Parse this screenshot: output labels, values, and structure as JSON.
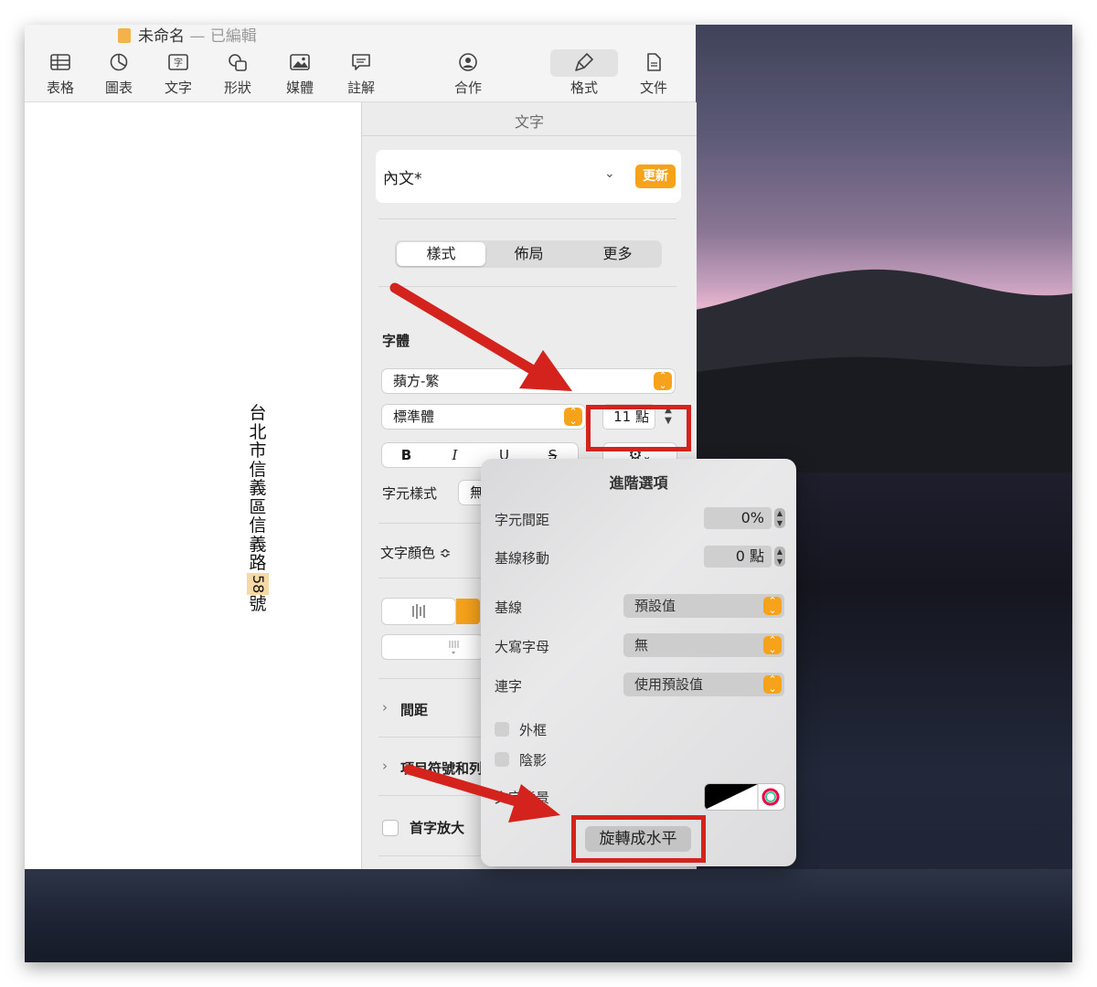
{
  "window": {
    "title": "未命名",
    "title_sep": " — ",
    "title_status": "已編輯"
  },
  "toolbar": {
    "items": [
      {
        "label": "表格",
        "icon": "table-icon"
      },
      {
        "label": "圖表",
        "icon": "chart-icon"
      },
      {
        "label": "文字",
        "icon": "text-box-icon"
      },
      {
        "label": "形狀",
        "icon": "shape-icon"
      },
      {
        "label": "媒體",
        "icon": "media-icon"
      },
      {
        "label": "註解",
        "icon": "comment-icon"
      },
      {
        "label": "合作",
        "icon": "collaborate-icon"
      },
      {
        "label": "格式",
        "icon": "format-brush-icon"
      },
      {
        "label": "文件",
        "icon": "document-icon"
      }
    ]
  },
  "canvas": {
    "vertical_text_chars": [
      "台",
      "北",
      "市",
      "信",
      "義",
      "區",
      "信",
      "義",
      "路"
    ],
    "number": "58",
    "last_char": "號"
  },
  "inspector": {
    "title": "文字",
    "paragraph_style": "內文*",
    "update_label": "更新",
    "tabs": [
      "樣式",
      "佈局",
      "更多"
    ],
    "font_section": "字體",
    "font_family": "蘋方-繁",
    "font_weight": "標準體",
    "font_size": "11 點",
    "bold": "B",
    "italic": "I",
    "underline": "U",
    "strike": "S",
    "char_style_label": "字元樣式",
    "char_style_value": "無",
    "text_color_label": "文字顏色 ≎",
    "spacing_label": "間距",
    "bullets_label": "項目符號和列",
    "drop_cap_label": "首字放大"
  },
  "popover": {
    "title": "進階選項",
    "char_spacing_label": "字元間距",
    "char_spacing_value": "0%",
    "baseline_shift_label": "基線移動",
    "baseline_shift_value": "0 點",
    "baseline_label": "基線",
    "baseline_value": "預設值",
    "capitalization_label": "大寫字母",
    "capitalization_value": "無",
    "ligatures_label": "連字",
    "ligatures_value": "使用預設值",
    "outline_label": "外框",
    "shadow_label": "陰影",
    "text_bg_label": "文字背景",
    "rotate_button": "旋轉成水平"
  },
  "colors": {
    "accent_orange": "#f7a21b",
    "annotation_red": "#d4231d"
  }
}
